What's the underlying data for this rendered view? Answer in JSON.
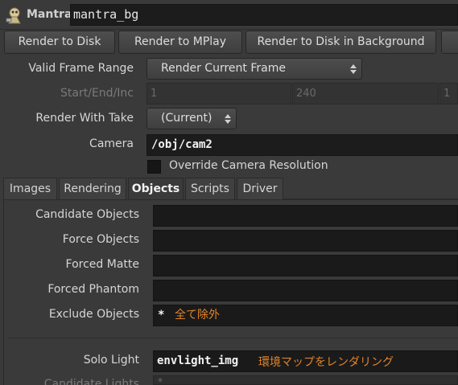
{
  "header": {
    "node_type": "Mantra",
    "node_name": "mantra_bg"
  },
  "actions": {
    "render_to_disk": "Render to Disk",
    "render_to_mplay": "Render to MPlay",
    "render_to_disk_bg": "Render to Disk in Background"
  },
  "params": {
    "valid_frame_range": {
      "label": "Valid Frame Range",
      "value": "Render Current Frame"
    },
    "start_end_inc": {
      "label": "Start/End/Inc",
      "start": "1",
      "end": "240",
      "inc": "1"
    },
    "render_with_take": {
      "label": "Render With Take",
      "value": "(Current)"
    },
    "camera": {
      "label": "Camera",
      "value": "/obj/cam2"
    },
    "override_res": {
      "label": "Override Camera Resolution",
      "checked": false
    }
  },
  "tabs": [
    {
      "label": "Images",
      "active": false
    },
    {
      "label": "Rendering",
      "active": false
    },
    {
      "label": "Objects",
      "active": true
    },
    {
      "label": "Scripts",
      "active": false
    },
    {
      "label": "Driver",
      "active": false
    }
  ],
  "objects": {
    "candidate_objects": {
      "label": "Candidate Objects",
      "value": ""
    },
    "force_objects": {
      "label": "Force Objects",
      "value": ""
    },
    "forced_matte": {
      "label": "Forced Matte",
      "value": ""
    },
    "forced_phantom": {
      "label": "Forced Phantom",
      "value": ""
    },
    "exclude_objects": {
      "label": "Exclude Objects",
      "value": "*",
      "note": "全て除外"
    },
    "solo_light": {
      "label": "Solo Light",
      "value": "envlight_img",
      "note": "環境マップをレンダリング"
    },
    "candidate_lights": {
      "label": "Candidate Lights",
      "value": "*"
    }
  },
  "colors": {
    "annotation": "#e0832a",
    "background": "#3a3a3a",
    "field": "#1a1a1a"
  }
}
